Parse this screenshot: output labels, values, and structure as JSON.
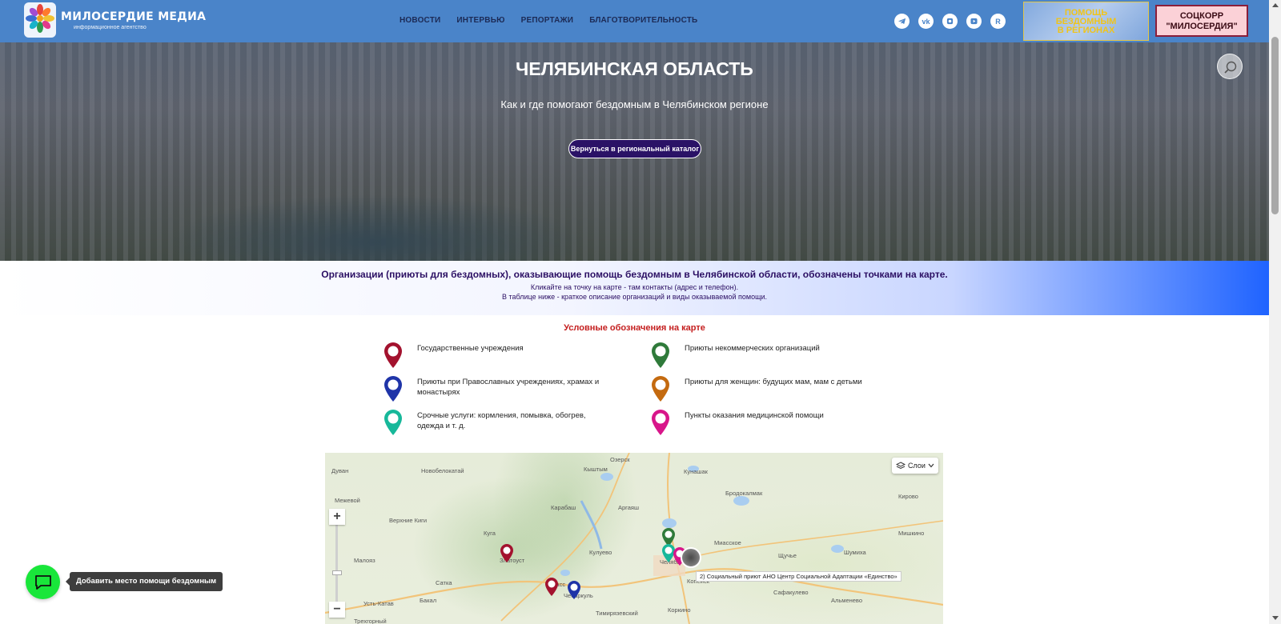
{
  "header": {
    "logo_title": "МИЛОСЕРДИЕ МЕДИА",
    "logo_subtitle": "информационное агентство",
    "nav": [
      "НОВОСТИ",
      "ИНТЕРВЬЮ",
      "РЕПОРТАЖИ",
      "БЛАГОТВОРИТЕЛЬНОСТЬ"
    ],
    "socials": [
      "telegram-icon",
      "vk-icon",
      "ok-icon",
      "youtube-icon",
      "rutube-icon"
    ],
    "help_button": [
      "ПОМОЩЬ",
      "БЕЗДОМНЫМ",
      "В РЕГИОНАХ"
    ],
    "soccorr_button": [
      "СОЦКОРР",
      "\"МИЛОСЕРДИЯ\""
    ]
  },
  "hero": {
    "title": "ЧЕЛЯБИНСКАЯ ОБЛАСТЬ",
    "subtitle": "Как и где помогают бездомным в Челябинском регионе",
    "back_button": "Вернуться в региональный каталог"
  },
  "band": {
    "title": "Организации (приюты для бездомных), оказывающие помощь бездомным в Челябинской области, обозначены точками на карте.",
    "line1": "Кликайте на точку на карте - там контакты (адрес и телефон).",
    "line2": "В таблице ниже - краткое описание организаций и виды оказываемой помощи."
  },
  "legend": {
    "title": "Условные обозначения на карте",
    "items": [
      {
        "label": "Государственные учреждения",
        "color": "#a3122e"
      },
      {
        "label": "Приюты некоммерческих организаций",
        "color": "#2f7a3a"
      },
      {
        "label": "Приюты при Православных учреждениях, храмах и монастырях",
        "color": "#1f34a8"
      },
      {
        "label": "Приюты для женщин: будущих мам, мам с детьми",
        "color": "#c46a0f"
      },
      {
        "label": "Срочные услуги: кормления, помывка, обогрев, одежда и т. д.",
        "color": "#17b89a"
      },
      {
        "label": "Пункты оказания медицинской помощи",
        "color": "#d8168a"
      }
    ]
  },
  "map": {
    "layers_label": "Слои",
    "zoom_in": "+",
    "zoom_out": "−",
    "tooltip": "2) Социальный приют АНО Центр Социальной Адаптации «Единство»",
    "places": [
      "Озерск",
      "Кыштым",
      "Кунашак",
      "Дуван",
      "Новобелокатай",
      "Бродокалмак",
      "Кирово",
      "Межевой",
      "Карабаш",
      "Аргаяш",
      "Верхние Киги",
      "Куга",
      "Миасское",
      "Мишкино",
      "Малояз",
      "Златоуст",
      "Кулуево",
      "Щучье",
      "Шумиха",
      "Сатка",
      "Миасс",
      "Челябинск",
      "Копейск",
      "Бакал",
      "Чебаркуль",
      "Сафакулево",
      "Усть-Катав",
      "Тимирязевский",
      "Коркино",
      "Альменево",
      "Трехгорный"
    ]
  },
  "fab": {
    "tooltip": "Добавить место помощи бездомным"
  }
}
